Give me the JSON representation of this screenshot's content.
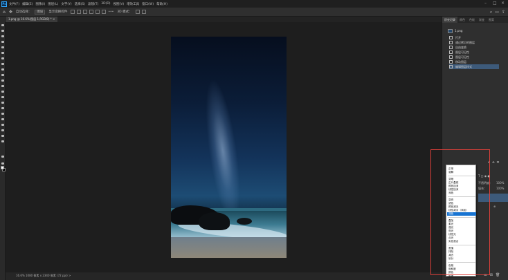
{
  "menubar": {
    "logo": "Ps",
    "items": [
      "文件(F)",
      "编辑(E)",
      "图像(I)",
      "图层(L)",
      "文字(Y)",
      "选择(S)",
      "滤镜(T)",
      "3D(D)",
      "视图(V)",
      "增效工具",
      "窗口(W)",
      "帮助(H)"
    ],
    "window_controls": [
      "–",
      "□",
      "×"
    ]
  },
  "options_bar": {
    "auto_select": "自动选择：",
    "layer": "图层",
    "show_transform": "显示变换控件",
    "more": "•••",
    "mode_3d": "3D 模式："
  },
  "document_tab": {
    "title": "1.png @ 16.6%(图层 1,RGB/8) *",
    "close": "×"
  },
  "status": {
    "text": "16.6%    1080 像素 x 2340 像素 (72 ppi)    >"
  },
  "panel": {
    "tabs": [
      "历史记录",
      "颜色",
      "色板",
      "渐变",
      "图案"
    ],
    "history_doc": "1.png",
    "history_items": [
      "打开",
      "通过拷贝的图层",
      "自由变换",
      "图层可见性",
      "图层可见性",
      "移动图层",
      "编辑图层样式"
    ],
    "layer_labels": {
      "opacity": "不透明度：",
      "opacity_value": "100%",
      "fill": "填充：",
      "fill_value": "100%"
    }
  },
  "blend_menu": {
    "items": [
      "正常",
      "溶解",
      "变暗",
      "正片叠底",
      "颜色加深",
      "线性加深",
      "深色",
      "变亮",
      "滤色",
      "颜色减淡",
      "线性减淡（添加）",
      "浅色",
      "叠加",
      "柔光",
      "强光",
      "亮光",
      "线性光",
      "点光",
      "实色混合",
      "差值",
      "排除",
      "减去",
      "划分",
      "色相",
      "饱和度",
      "颜色",
      "明度"
    ],
    "highlighted_index": 11,
    "separators_after": [
      1,
      6,
      11,
      18,
      22
    ]
  }
}
